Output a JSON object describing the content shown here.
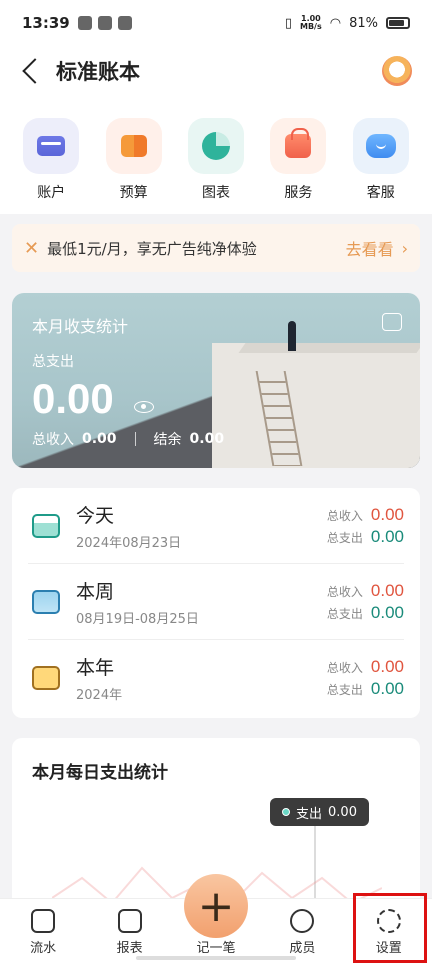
{
  "status_bar": {
    "time": "13:39",
    "net_speed_top": "1.00",
    "net_speed_bottom": "MB/s",
    "battery": "81%"
  },
  "header": {
    "title": "标准账本"
  },
  "quick_actions": [
    {
      "label": "账户",
      "icon": "account-card-icon"
    },
    {
      "label": "预算",
      "icon": "budget-icon"
    },
    {
      "label": "图表",
      "icon": "pie-chart-icon"
    },
    {
      "label": "服务",
      "icon": "shopping-bag-icon"
    },
    {
      "label": "客服",
      "icon": "customer-service-icon"
    }
  ],
  "promo": {
    "text": "最低1元/月，享无广告纯净体验",
    "link": "去看看"
  },
  "monthly_stats": {
    "title": "本月收支统计",
    "expense_label": "总支出",
    "expense_value": "0.00",
    "income_label": "总收入",
    "income_value": "0.00",
    "balance_label": "结余",
    "balance_value": "0.00"
  },
  "periods": [
    {
      "title": "今天",
      "date": "2024年08月23日",
      "income_label": "总收入",
      "income": "0.00",
      "expense_label": "总支出",
      "expense": "0.00"
    },
    {
      "title": "本周",
      "date": "08月19日-08月25日",
      "income_label": "总收入",
      "income": "0.00",
      "expense_label": "总支出",
      "expense": "0.00"
    },
    {
      "title": "本年",
      "date": "2024年",
      "income_label": "总收入",
      "income": "0.00",
      "expense_label": "总支出",
      "expense": "0.00"
    }
  ],
  "daily_chart": {
    "title": "本月每日支出统计",
    "tooltip_label": "支出",
    "tooltip_value": "0.00"
  },
  "fab": {
    "symbol": "+"
  },
  "tabbar": [
    {
      "label": "流水"
    },
    {
      "label": "报表"
    },
    {
      "label": "记一笔"
    },
    {
      "label": "成员"
    },
    {
      "label": "设置"
    }
  ],
  "colors": {
    "income": "#e0553f",
    "expense": "#1a8b7a",
    "accent": "#e69a54",
    "highlight": "#dd1111"
  }
}
